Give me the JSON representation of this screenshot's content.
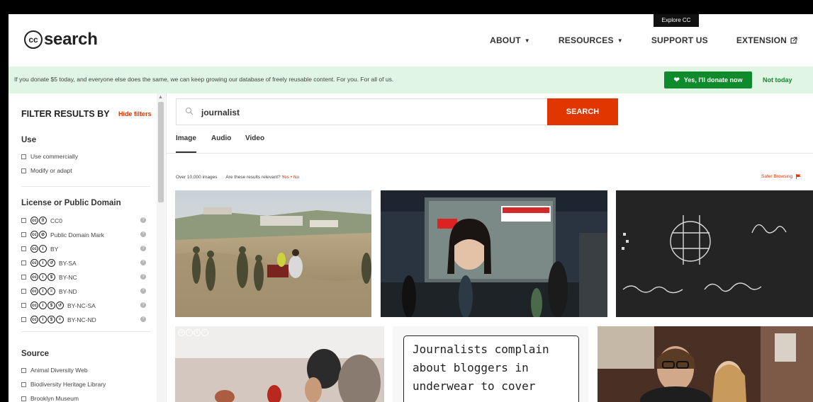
{
  "tooltip": "Explore CC",
  "header": {
    "logo_cc": "cc",
    "logo_text": "search",
    "nav": {
      "about": "ABOUT",
      "resources": "RESOURCES",
      "support": "SUPPORT US",
      "extension": "EXTENSION"
    }
  },
  "banner": {
    "text": "If you donate $5 today, and everyone else does the same, we can keep growing our database of freely reusable content. For you. For all of us.",
    "donate_label": "Yes, I'll donate now",
    "not_today": "Not today"
  },
  "sidebar": {
    "title": "FILTER RESULTS BY",
    "hide_filters": "Hide filters",
    "use": {
      "heading": "Use",
      "items": [
        "Use commercially",
        "Modify or adapt"
      ]
    },
    "license": {
      "heading": "License or Public Domain",
      "items": [
        {
          "label": "CC0",
          "icons": [
            "cc",
            "0"
          ]
        },
        {
          "label": "Public Domain Mark",
          "icons": [
            "cc",
            "pd"
          ]
        },
        {
          "label": "BY",
          "icons": [
            "cc",
            "by"
          ]
        },
        {
          "label": "BY-SA",
          "icons": [
            "cc",
            "by",
            "sa"
          ]
        },
        {
          "label": "BY-NC",
          "icons": [
            "cc",
            "by",
            "nc"
          ]
        },
        {
          "label": "BY-ND",
          "icons": [
            "cc",
            "by",
            "nd"
          ]
        },
        {
          "label": "BY-NC-SA",
          "icons": [
            "cc",
            "by",
            "nc",
            "sa"
          ]
        },
        {
          "label": "BY-NC-ND",
          "icons": [
            "cc",
            "by",
            "nc",
            "nd"
          ]
        }
      ]
    },
    "source": {
      "heading": "Source",
      "items": [
        "Animal Diversity Web",
        "Biodiversity Heritage Library",
        "Brooklyn Museum"
      ]
    }
  },
  "search": {
    "value": "journalist",
    "button": "SEARCH"
  },
  "tabs": [
    "Image",
    "Audio",
    "Video"
  ],
  "results": {
    "count": "Over 10,000 images",
    "relevant_q": "Are these results relevant?",
    "yes": "Yes",
    "sep": "•",
    "no": "No",
    "safer": "Safer Browsing"
  },
  "note_text": [
    "Journalists complain",
    "about bloggers in",
    "underwear to cover"
  ],
  "colors": {
    "accent": "#e23600",
    "donate_green": "#0f8a2c",
    "banner_bg": "#e1f5e4"
  }
}
